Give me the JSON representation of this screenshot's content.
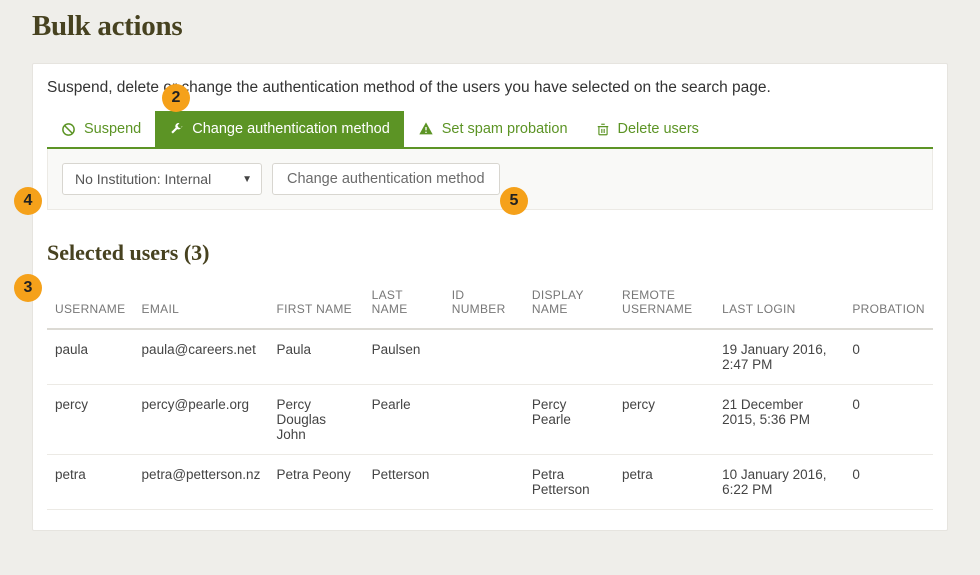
{
  "page_title": "Bulk actions",
  "intro": "Suspend, delete or change the authentication method of the users you have selected on the search page.",
  "tabs": {
    "suspend": "Suspend",
    "change_auth": "Change authentication method",
    "spam": "Set spam probation",
    "delete": "Delete users"
  },
  "form": {
    "institution_options": [
      "No Institution: Internal"
    ],
    "institution_selected": "No Institution: Internal",
    "submit_label": "Change authentication method"
  },
  "selected_users": {
    "heading": "Selected users (3)",
    "columns": {
      "username": "USERNAME",
      "email": "EMAIL",
      "first_name": "FIRST NAME",
      "last_name": "LAST NAME",
      "id_number": "ID NUMBER",
      "display_name": "DISPLAY NAME",
      "remote_username": "REMOTE USERNAME",
      "last_login": "LAST LOGIN",
      "probation": "PROBATION"
    },
    "rows": [
      {
        "username": "paula",
        "email": "paula@careers.net",
        "first_name": "Paula",
        "last_name": "Paulsen",
        "id_number": "",
        "display_name": "",
        "remote_username": "",
        "last_login": "19 January 2016, 2:47 PM",
        "probation": "0"
      },
      {
        "username": "percy",
        "email": "percy@pearle.org",
        "first_name": "Percy Douglas John",
        "last_name": "Pearle",
        "id_number": "",
        "display_name": "Percy Pearle",
        "remote_username": "percy",
        "last_login": "21 December 2015, 5:36 PM",
        "probation": "0"
      },
      {
        "username": "petra",
        "email": "petra@petterson.nz",
        "first_name": "Petra Peony",
        "last_name": "Petterson",
        "id_number": "",
        "display_name": "Petra Petterson",
        "remote_username": "petra",
        "last_login": "10 January 2016, 6:22 PM",
        "probation": "0"
      }
    ]
  },
  "annotations": {
    "2": "2",
    "3": "3",
    "4": "4",
    "5": "5"
  }
}
